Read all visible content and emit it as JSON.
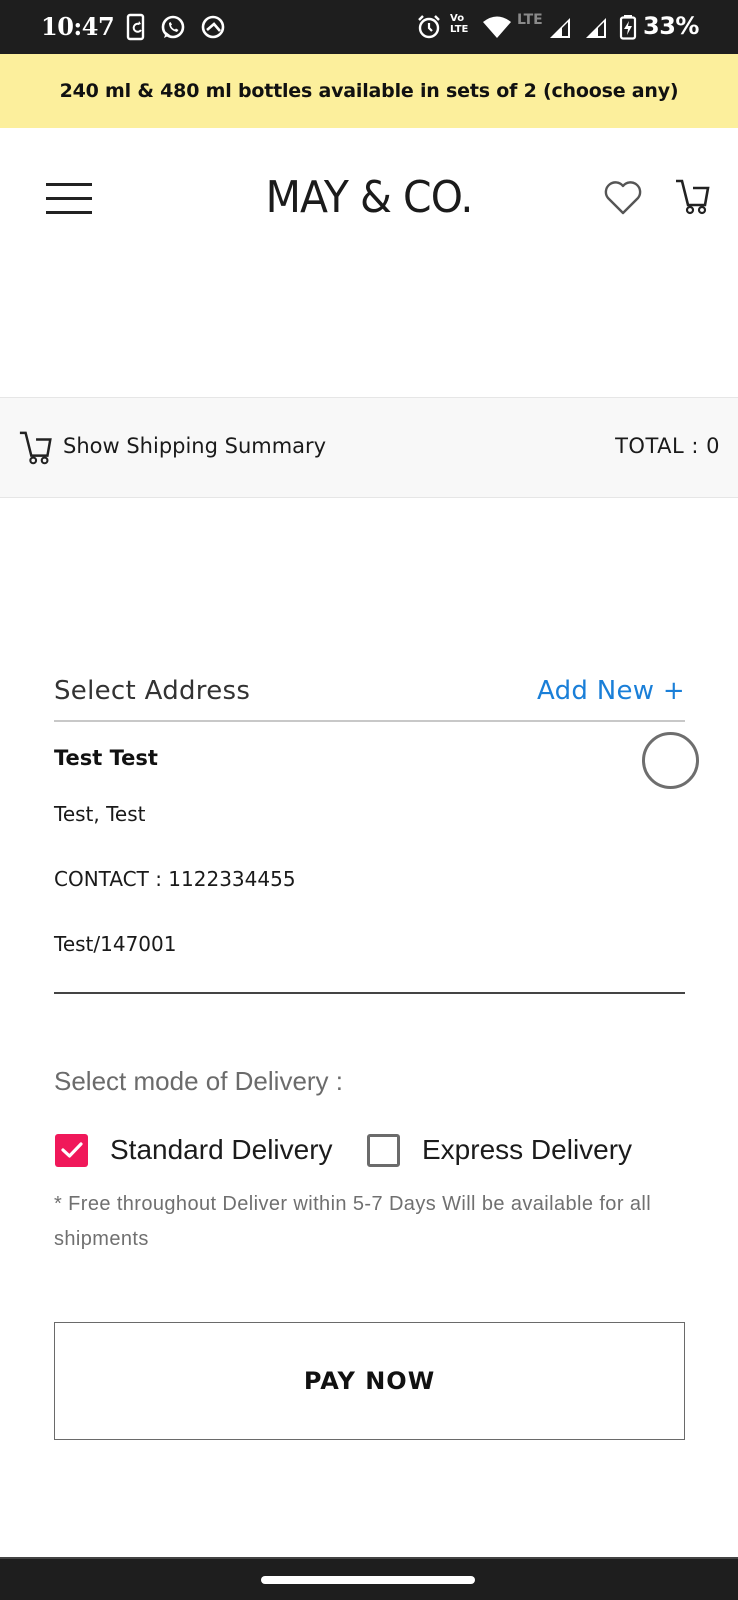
{
  "status_bar": {
    "time": "10:47",
    "left_icons": [
      "screen-rotate-icon",
      "whatsapp-icon",
      "app-notification-icon"
    ],
    "right_icons": [
      "alarm-icon",
      "volte-icon",
      "wifi-icon",
      "lte-icon",
      "signal-icon",
      "signal-icon",
      "battery-charging-icon"
    ],
    "volte_top": "Vo",
    "volte_bottom": "LTE",
    "lte_label": "LTE",
    "battery": "33%"
  },
  "promo": {
    "text": "240 ml & 480 ml bottles available in sets of 2 (choose any)",
    "background": "#fcef9c"
  },
  "header": {
    "brand": "MAY & CO.",
    "icons": [
      "menu-icon",
      "heart-icon",
      "cart-icon"
    ]
  },
  "shipping_summary": {
    "label": "Show Shipping Summary",
    "total": "TOTAL : 0"
  },
  "address": {
    "title": "Select Address",
    "add_new": "Add New +",
    "accent": "#1a7fd8",
    "entries": [
      {
        "name": "Test Test",
        "line1": "Test, Test",
        "contact": "CONTACT : 1122334455",
        "city_pin": "Test/147001",
        "selected": false
      }
    ]
  },
  "delivery": {
    "title": "Select mode of Delivery :",
    "options": [
      {
        "label": "Standard Delivery",
        "checked": true
      },
      {
        "label": "Express Delivery",
        "checked": false
      }
    ],
    "note": "* Free throughout Deliver within 5-7 Days Will be available for all shipments",
    "accent": "#f0185a"
  },
  "pay_button": {
    "label": "PAY NOW"
  }
}
